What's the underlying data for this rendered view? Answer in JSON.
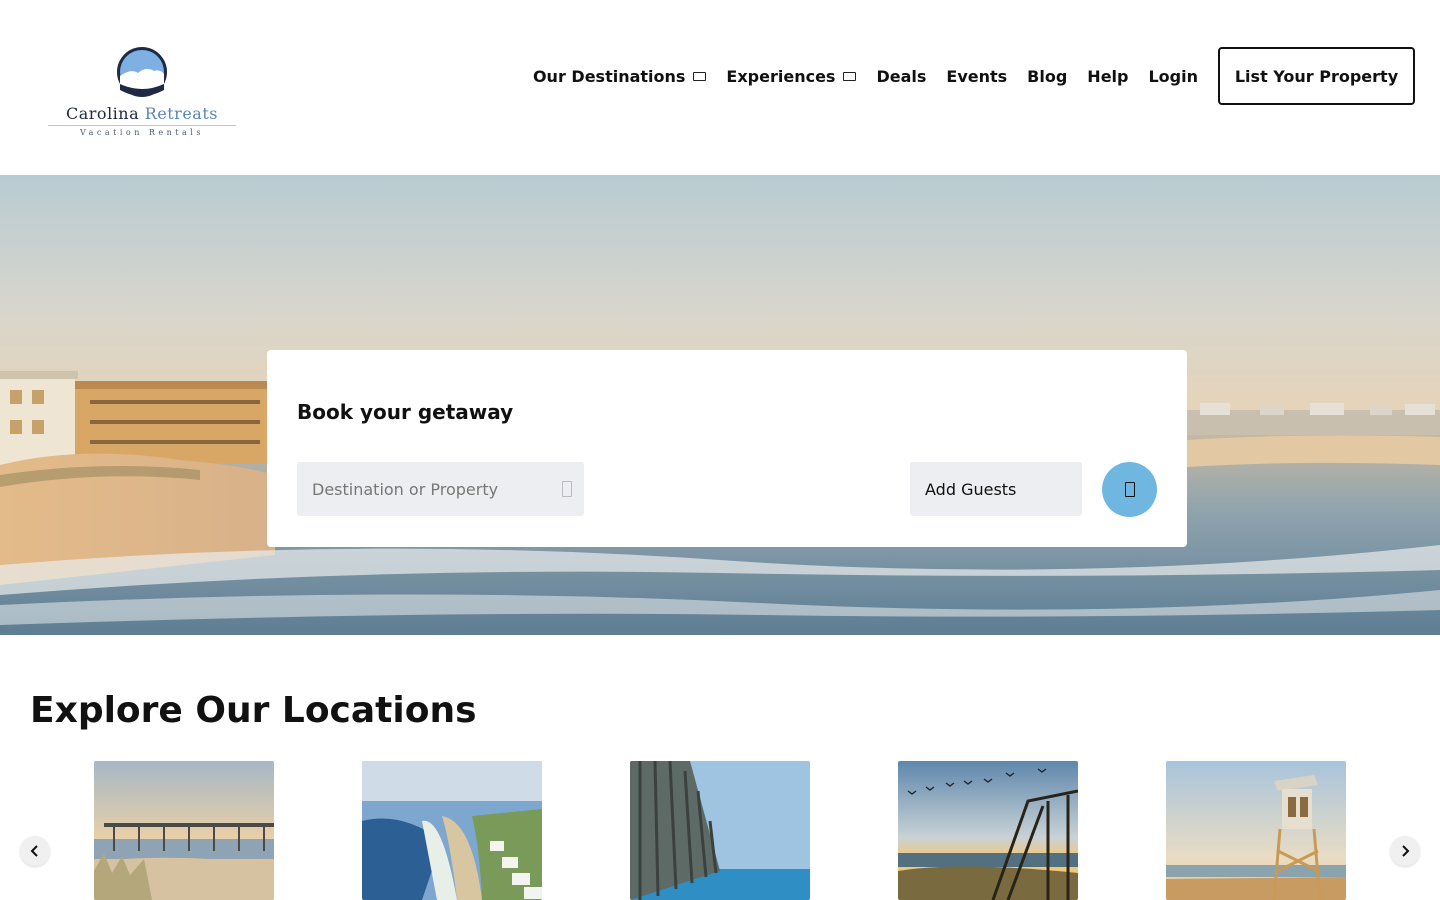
{
  "brand": {
    "name_part1": "Carolina",
    "name_part2": "Retreats",
    "tagline": "Vacation Rentals"
  },
  "nav": {
    "items": [
      {
        "label": "Our Destinations",
        "has_dropdown": true
      },
      {
        "label": "Experiences",
        "has_dropdown": true
      },
      {
        "label": "Deals",
        "has_dropdown": false
      },
      {
        "label": "Events",
        "has_dropdown": false
      },
      {
        "label": "Blog",
        "has_dropdown": false
      },
      {
        "label": "Help",
        "has_dropdown": false
      },
      {
        "label": "Login",
        "has_dropdown": false
      }
    ],
    "cta_label": "List Your Property"
  },
  "booking": {
    "title": "Book your getaway",
    "destination_placeholder": "Destination or Property",
    "guests_label": "Add Guests",
    "search_icon": "search-icon"
  },
  "explore": {
    "title": "Explore Our Locations",
    "cards": [
      {
        "scene": "fishing pier at sunset with dune grass"
      },
      {
        "scene": "aerial coastline with beach houses"
      },
      {
        "scene": "pier pilings over blue water"
      },
      {
        "scene": "beach access stairs with birds at sunset"
      },
      {
        "scene": "lifeguard stand on beach"
      }
    ],
    "prev_icon": "chevron-left-icon",
    "next_icon": "chevron-right-icon"
  },
  "colors": {
    "accent": "#6fb7e0",
    "field_bg": "#eceef1",
    "brand_navy": "#1e2a44",
    "brand_blue": "#5b86b8"
  }
}
